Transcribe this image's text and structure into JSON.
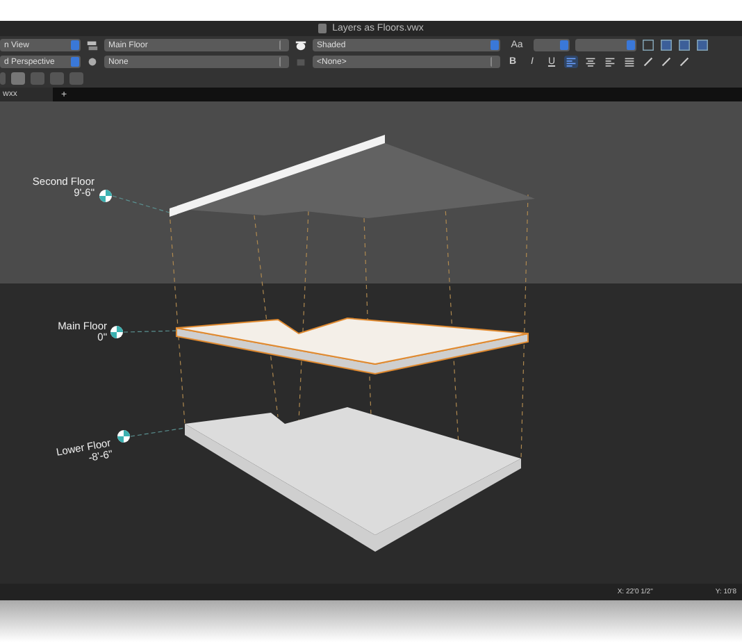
{
  "window": {
    "title": "Layers as Floors.vwx"
  },
  "toolbar": {
    "view_dropdown": "n View",
    "projection_dropdown": "d Perspective",
    "layer_dropdown": "Main Floor",
    "class_dropdown": "None",
    "render_dropdown": "Shaded",
    "plane_dropdown": "<None>",
    "font_button": "Aa",
    "text_styles": [
      {
        "label": "B",
        "selected": false
      },
      {
        "label": "I",
        "selected": false
      },
      {
        "label": "U",
        "selected": false
      }
    ],
    "alignments": [
      {
        "selected": true
      },
      {
        "selected": false
      },
      {
        "selected": false
      },
      {
        "selected": false
      }
    ]
  },
  "tabs": [
    {
      "label": "wxx",
      "selected": true
    }
  ],
  "new_tab_button": "+",
  "floors": [
    {
      "name": "Second Floor",
      "elevation": "9'-6\"",
      "selected": false
    },
    {
      "name": "Main Floor",
      "elevation": "0\"",
      "selected": true
    },
    {
      "name": "Lower Floor",
      "elevation": "-8'-6\"",
      "selected": false
    }
  ],
  "status_bar": {
    "x": "X: 22'0 1/2\"",
    "y": "Y: 10'8"
  }
}
